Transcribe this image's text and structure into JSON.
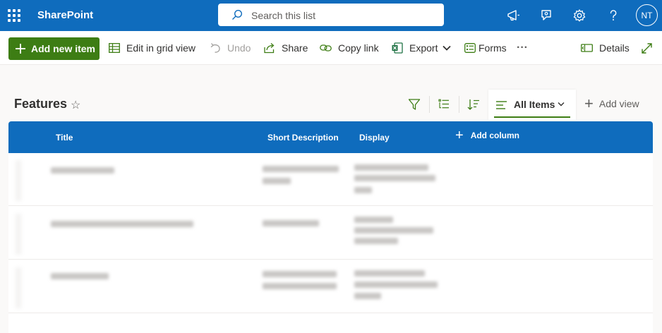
{
  "suite": {
    "app_name": "SharePoint",
    "search_placeholder": "Search this list",
    "avatar_initials": "NT",
    "icons": [
      "waffle-icon",
      "megaphone-icon",
      "feedback-icon",
      "gear-icon",
      "help-icon"
    ]
  },
  "commands": {
    "new_item": "Add new item",
    "grid_view": "Edit in grid view",
    "undo": "Undo",
    "share": "Share",
    "copy_link": "Copy link",
    "export": "Export",
    "forms": "Forms",
    "more": "···",
    "details": "Details"
  },
  "list": {
    "title": "Features",
    "view_name": "All Items",
    "add_view": "Add view"
  },
  "columns": {
    "title": "Title",
    "short_description": "Short Description",
    "display": "Display",
    "add_column": "Add column"
  },
  "colors": {
    "brand_blue": "#0f6cbd",
    "accent_green": "#3d7d14",
    "excel_green": "#217346"
  }
}
